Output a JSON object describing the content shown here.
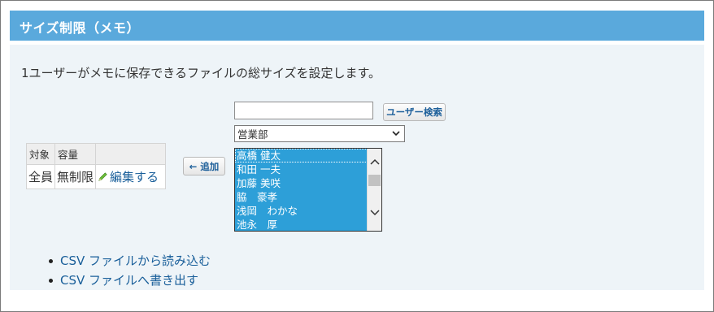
{
  "header": {
    "title": "サイズ制限（メモ）"
  },
  "description": "1ユーザーがメモに保存できるファイルの総サイズを設定します。",
  "settings_table": {
    "headers": [
      "対象",
      "容量",
      ""
    ],
    "row": {
      "target": "全員",
      "capacity": "無制限",
      "edit_label": "編集する"
    }
  },
  "add_button": "← 追加",
  "user_search": {
    "input_value": "",
    "button_label": "ユーザー検索"
  },
  "department_select": {
    "selected": "営業部"
  },
  "user_list": [
    "高橋 健太",
    "和田 一夫",
    "加藤 美咲",
    "脇　豪孝",
    "浅岡　わかな",
    "池永　厚"
  ],
  "links": [
    "CSV ファイルから読み込む",
    "CSV ファイルへ書き出す"
  ],
  "colors": {
    "header_bg": "#5aa9dc",
    "panel_bg": "#eef4f8",
    "list_selected": "#2d9fd8",
    "link": "#1a5f9a"
  },
  "icons": {
    "edit": "pencil-icon",
    "select": "chevron-down-icon"
  }
}
